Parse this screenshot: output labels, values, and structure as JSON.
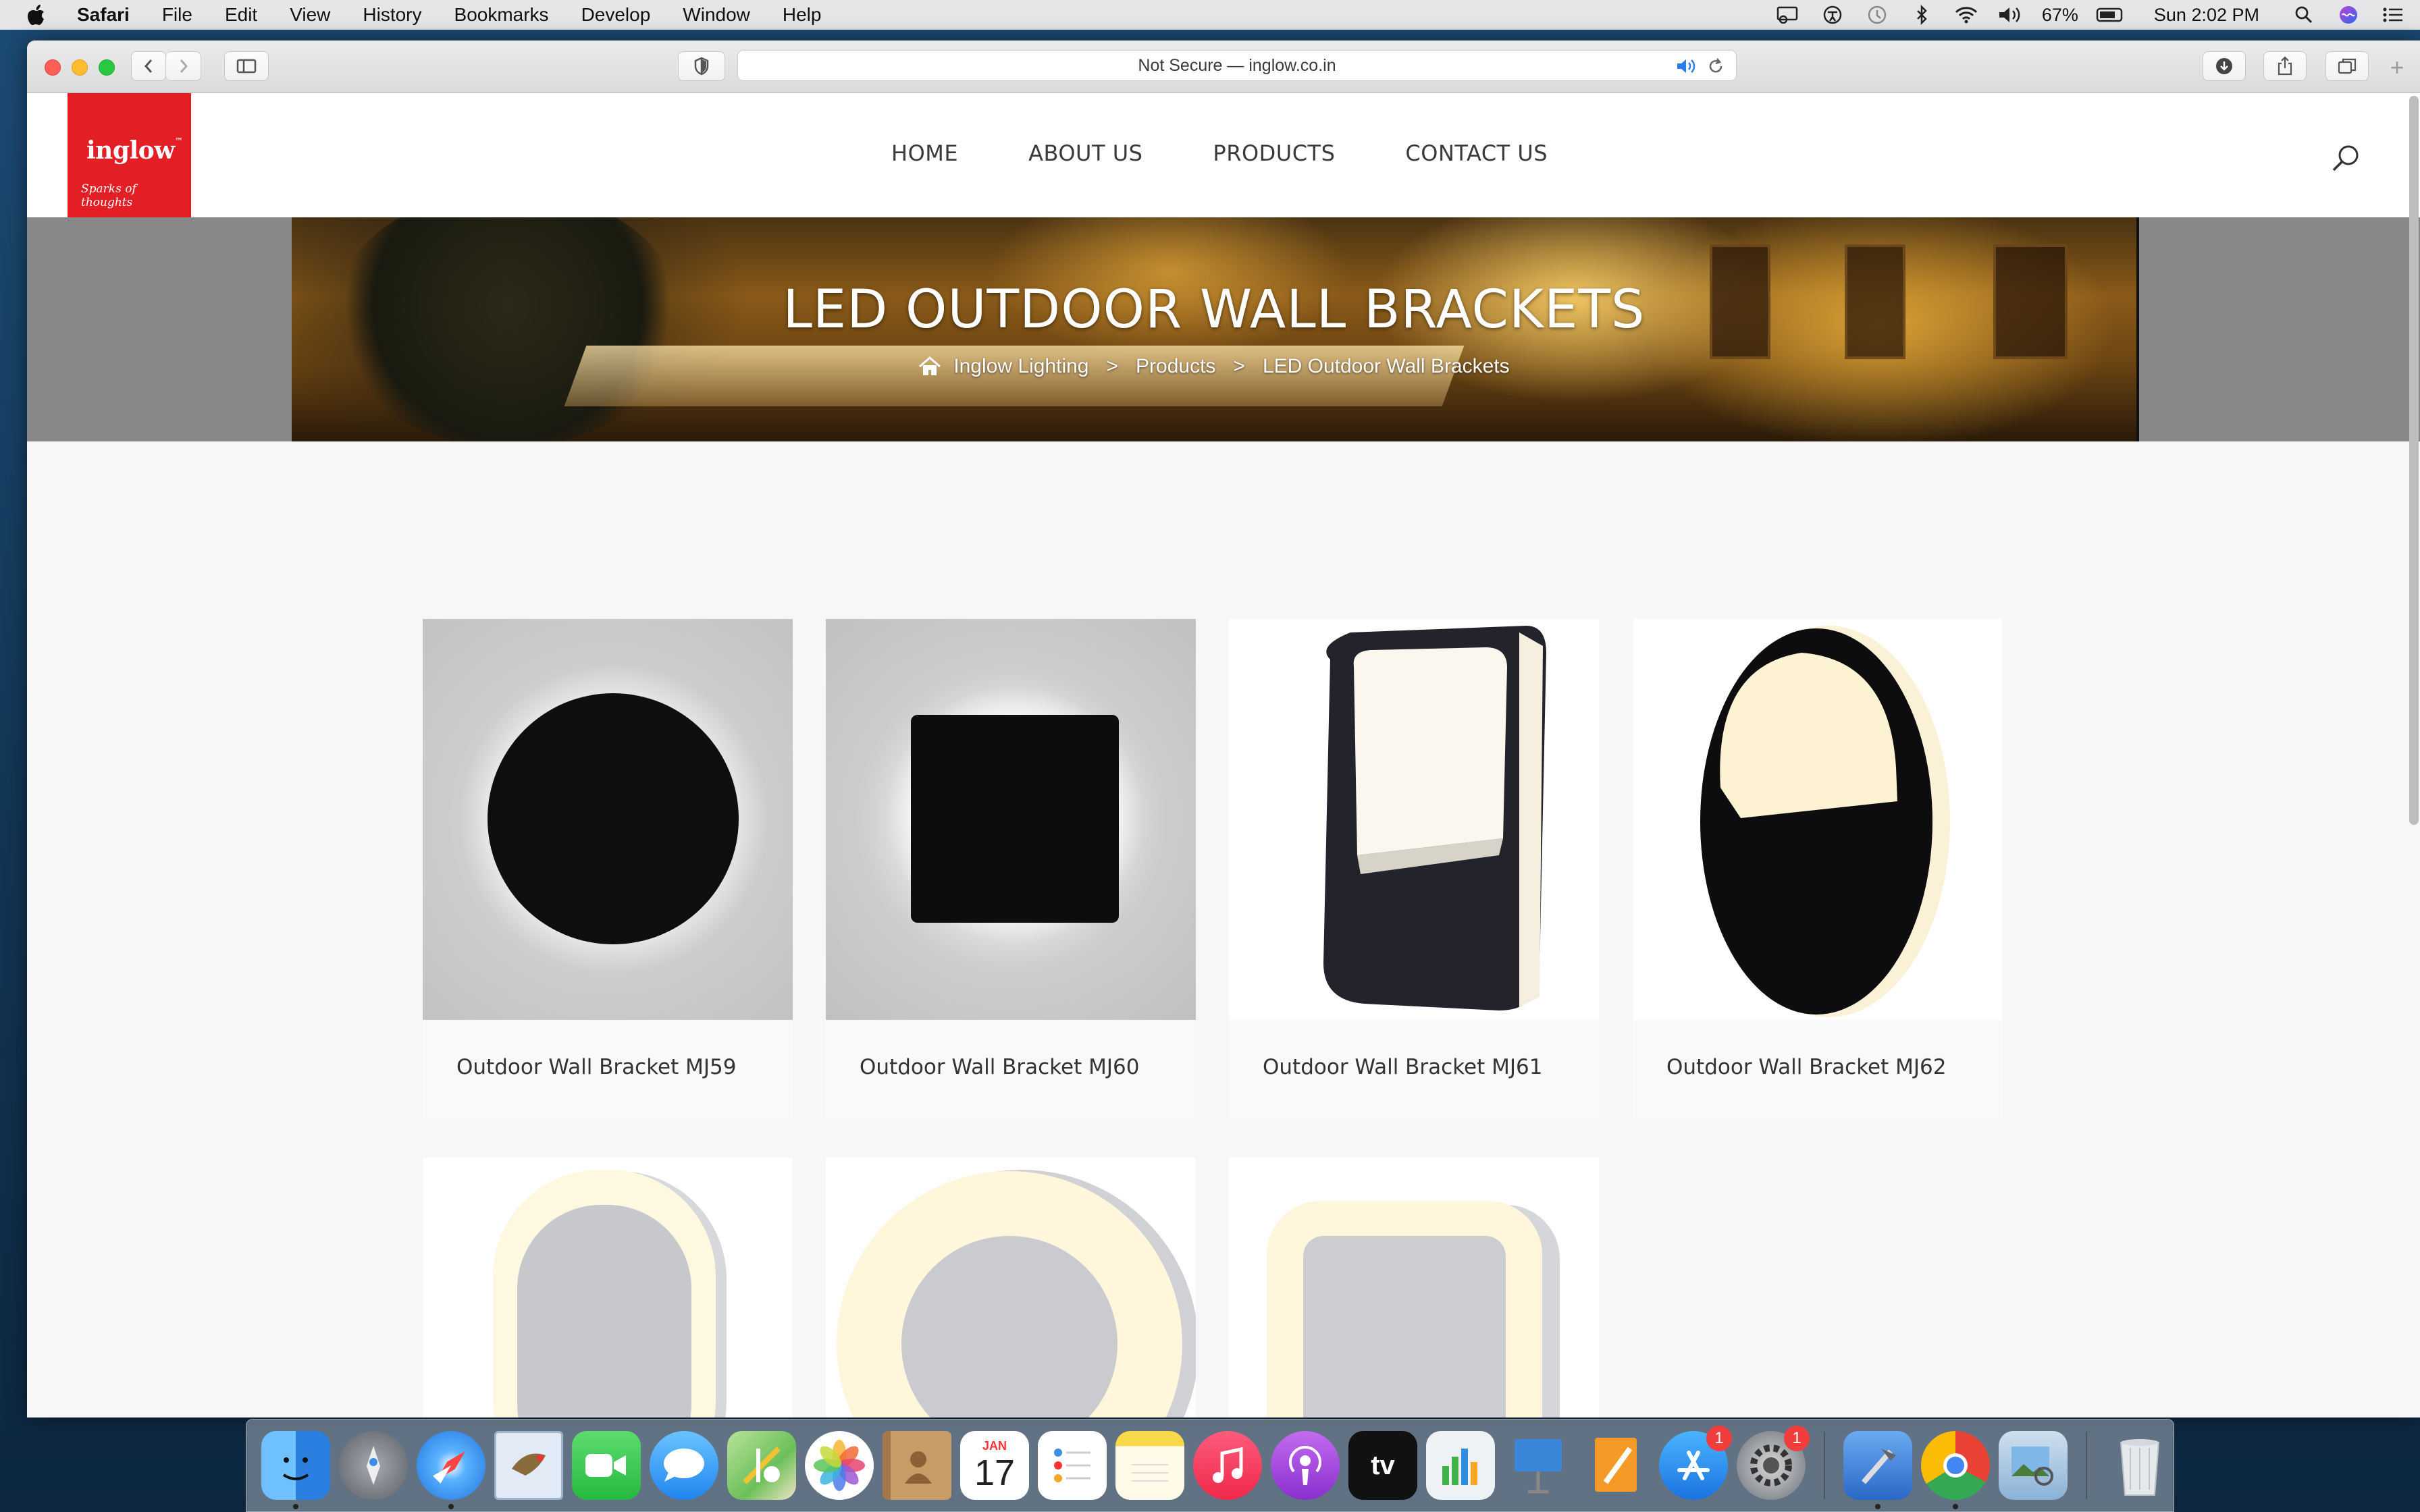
{
  "menubar": {
    "app_name": "Safari",
    "menus": [
      "File",
      "Edit",
      "View",
      "History",
      "Bookmarks",
      "Develop",
      "Window",
      "Help"
    ],
    "battery": "67%",
    "clock": "Sun 2:02 PM",
    "status_icons": [
      "screen-mirroring-icon",
      "accessibility-icon",
      "time-machine-icon",
      "bluetooth-icon",
      "wifi-icon",
      "volume-icon",
      "battery-icon",
      "spotlight-icon",
      "siri-icon",
      "control-list-icon"
    ]
  },
  "browser": {
    "address_text": "Not Secure — inglow.co.in",
    "new_tab_label": "+"
  },
  "site": {
    "logo": {
      "brand": "inglow",
      "tm": "™",
      "tagline": "Sparks of thoughts",
      "color": "#e31e24"
    },
    "nav": [
      "HOME",
      "ABOUT US",
      "PRODUCTS",
      "CONTACT US"
    ],
    "banner": {
      "title": "LED OUTDOOR WALL BRACKETS",
      "breadcrumb": [
        "Inglow Lighting",
        "Products",
        "LED Outdoor Wall Brackets"
      ],
      "separator": ">"
    },
    "products": [
      {
        "name": "Outdoor Wall Bracket MJ59",
        "shape": "round-black-halo"
      },
      {
        "name": "Outdoor Wall Bracket MJ60",
        "shape": "square-black-halo"
      },
      {
        "name": "Outdoor Wall Bracket MJ61",
        "shape": "rectangular-black-bulkhead"
      },
      {
        "name": "Outdoor Wall Bracket MJ62",
        "shape": "oval-black-bulkhead"
      },
      {
        "name": "",
        "shape": "oval-white-ring"
      },
      {
        "name": "",
        "shape": "round-white-ring"
      },
      {
        "name": "",
        "shape": "square-white-ring"
      }
    ]
  },
  "dock": {
    "apps": [
      {
        "name": "Finder",
        "icon": "finder-icon",
        "color": "#3a9bf0"
      },
      {
        "name": "Launchpad",
        "icon": "launchpad-icon",
        "color": "#8a8f99"
      },
      {
        "name": "Safari",
        "icon": "safari-icon",
        "color": "#2b8ef0"
      },
      {
        "name": "Mail",
        "icon": "mail-icon",
        "color": "#c7d8ec"
      },
      {
        "name": "FaceTime",
        "icon": "facetime-icon",
        "color": "#2fc54a"
      },
      {
        "name": "Messages",
        "icon": "messages-icon",
        "color": "#3aa1f5"
      },
      {
        "name": "Maps",
        "icon": "maps-icon",
        "color": "#7cc06a"
      },
      {
        "name": "Photos",
        "icon": "photos-icon",
        "color": "#ffffff"
      },
      {
        "name": "Contacts",
        "icon": "contacts-icon",
        "color": "#b98d5c"
      },
      {
        "name": "Calendar",
        "icon": "calendar-icon",
        "color": "#ffffff",
        "month": "JAN",
        "day": "17"
      },
      {
        "name": "Reminders",
        "icon": "reminders-icon",
        "color": "#ffffff"
      },
      {
        "name": "Notes",
        "icon": "notes-icon",
        "color": "#f7dc63"
      },
      {
        "name": "Music",
        "icon": "music-icon",
        "color": "#fa3c5a"
      },
      {
        "name": "Podcasts",
        "icon": "podcasts-icon",
        "color": "#9b4bdc"
      },
      {
        "name": "TV",
        "icon": "apple-tv-icon",
        "color": "#111111",
        "label": "tv"
      },
      {
        "name": "Numbers",
        "icon": "numbers-icon",
        "color": "#e8eef2"
      },
      {
        "name": "Keynote",
        "icon": "keynote-icon",
        "color": "#3b86d8"
      },
      {
        "name": "Pages",
        "icon": "pages-icon",
        "color": "#f59a26"
      },
      {
        "name": "App Store",
        "icon": "app-store-icon",
        "color": "#2a8cf0",
        "badge": "1"
      },
      {
        "name": "System Preferences",
        "icon": "system-preferences-icon",
        "color": "#7a7f88",
        "badge": "1"
      },
      {
        "name": "Xcode",
        "icon": "xcode-icon",
        "color": "#3b7fd6"
      },
      {
        "name": "Chrome",
        "icon": "chrome-icon",
        "color": "#ffffff"
      },
      {
        "name": "Preview",
        "icon": "preview-icon",
        "color": "#c9d8e6"
      },
      {
        "name": "Trash",
        "icon": "trash-icon",
        "color": "#d9dde2"
      }
    ]
  }
}
